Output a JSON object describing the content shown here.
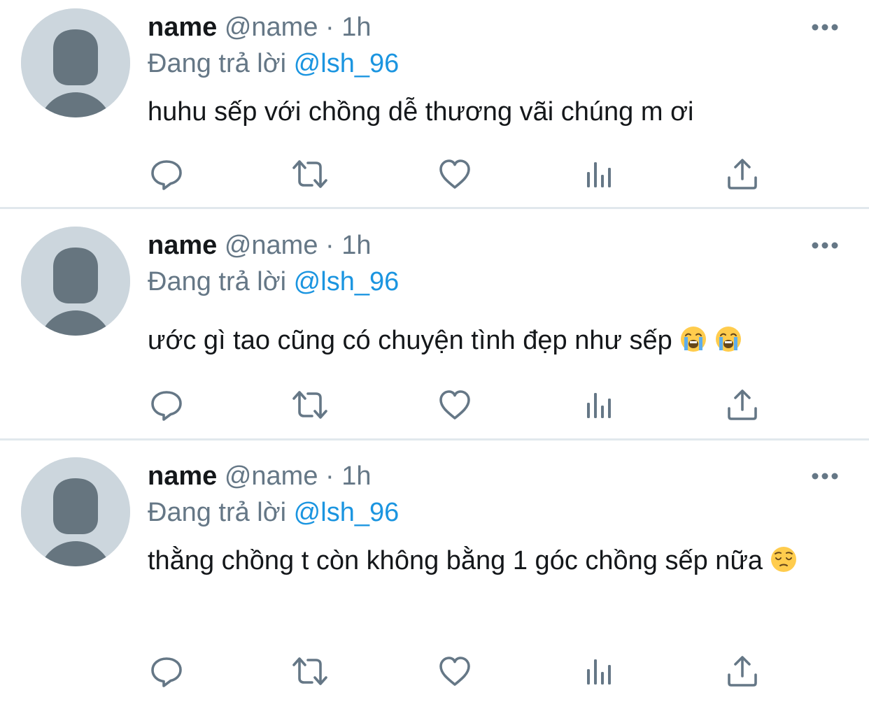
{
  "icons": {
    "avatar": "default-avatar-icon",
    "more": "more-options-icon",
    "reply": "reply-icon",
    "retweet": "retweet-icon",
    "like": "like-icon",
    "analytics": "analytics-icon",
    "share": "share-icon"
  },
  "colors": {
    "text": "#14171a",
    "secondary": "#657786",
    "link": "#1b95e0",
    "avatar_bg": "#ccd6dd",
    "avatar_fg": "#66757f",
    "divider": "#e1e8ed"
  },
  "tweets": [
    {
      "name": "name",
      "handle": "@name",
      "separator": "·",
      "time": "1h",
      "reply_prefix": "Đang trả lời",
      "reply_to": "@lsh_96",
      "text": "huhu sếp với chồng dễ thương vãi chúng m ơi",
      "emojis": []
    },
    {
      "name": "name",
      "handle": "@name",
      "separator": "·",
      "time": "1h",
      "reply_prefix": "Đang trả lời",
      "reply_to": "@lsh_96",
      "text": "ước gì tao cũng có chuyện tình đẹp như sếp",
      "emojis": [
        "loudly-crying-face",
        "loudly-crying-face"
      ]
    },
    {
      "name": "name",
      "handle": "@name",
      "separator": "·",
      "time": "1h",
      "reply_prefix": "Đang trả lời",
      "reply_to": "@lsh_96",
      "text": "thằng chồng t còn không bằng 1 góc chồng sếp nữa",
      "emojis": [
        "pensive-face"
      ]
    }
  ]
}
